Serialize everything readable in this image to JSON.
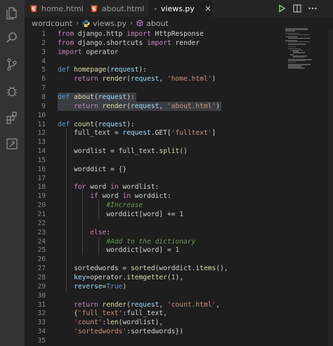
{
  "colors": {
    "activity_bg": "#333333",
    "editor_bg": "#1e1e1e",
    "tab_inactive_bg": "#252526",
    "html_icon": "#e44d26",
    "python_blue": "#3c78aa",
    "python_yellow": "#f7d046",
    "keyword": "#c586c0",
    "string": "#ce9178",
    "function": "#dcdcaa",
    "comment": "#6a9955",
    "number": "#b5cea8",
    "selection": "#3a3d41",
    "run_green": "#89d185"
  },
  "activity_bar": {
    "items": [
      {
        "name": "explorer-icon"
      },
      {
        "name": "search-icon"
      },
      {
        "name": "source-control-icon"
      },
      {
        "name": "run-debug-icon"
      },
      {
        "name": "extensions-icon"
      },
      {
        "name": "remote-explorer-icon"
      }
    ]
  },
  "tabs": [
    {
      "label": "home.html",
      "icon": "html5-icon",
      "active": false
    },
    {
      "label": "about.html",
      "icon": "html5-icon",
      "active": false
    },
    {
      "label": "views.py",
      "icon": "python-icon",
      "active": true,
      "close": "×"
    }
  ],
  "tab_actions": [
    {
      "name": "run-icon"
    },
    {
      "name": "split-editor-icon"
    },
    {
      "name": "more-actions-icon"
    }
  ],
  "breadcrumb": {
    "folder": "wordcount",
    "file": "views.py",
    "symbol": "about",
    "separator": "›"
  },
  "editor": {
    "selected_lines": [
      8,
      9
    ],
    "lines": [
      {
        "n": "1",
        "text": "from django.http import HttpResponse"
      },
      {
        "n": "2",
        "text": "from django.shortcuts import render"
      },
      {
        "n": "3",
        "text": "import operator"
      },
      {
        "n": "4",
        "text": ""
      },
      {
        "n": "5",
        "text": "def homepage(request):"
      },
      {
        "n": "6",
        "text": "    return render(request, 'home.html')"
      },
      {
        "n": "7",
        "text": ""
      },
      {
        "n": "8",
        "text": "def about(request):"
      },
      {
        "n": "9",
        "text": "    return render(request, 'about.html')"
      },
      {
        "n": "10",
        "text": ""
      },
      {
        "n": "11",
        "text": "def count(request):"
      },
      {
        "n": "12",
        "text": "    full_text = request.GET['fulltext']"
      },
      {
        "n": "13",
        "text": ""
      },
      {
        "n": "14",
        "text": "    wordlist = full_text.split()"
      },
      {
        "n": "15",
        "text": ""
      },
      {
        "n": "16",
        "text": "    worddict = {}"
      },
      {
        "n": "17",
        "text": ""
      },
      {
        "n": "18",
        "text": "    for word in wordlist:"
      },
      {
        "n": "19",
        "text": "        if word in worddict:"
      },
      {
        "n": "20",
        "text": "            #Increase"
      },
      {
        "n": "21",
        "text": "            worddict[word] += 1"
      },
      {
        "n": "22",
        "text": ""
      },
      {
        "n": "23",
        "text": "        else:"
      },
      {
        "n": "24",
        "text": "            #Add to the dictionary"
      },
      {
        "n": "25",
        "text": "            worddict[word] = 1"
      },
      {
        "n": "26",
        "text": ""
      },
      {
        "n": "27",
        "text": "    sortedwords = sorted(worddict.items(),"
      },
      {
        "n": "28",
        "text": "    key=operator.itemgetter(1),"
      },
      {
        "n": "29",
        "text": "    reverse=True)"
      },
      {
        "n": "30",
        "text": ""
      },
      {
        "n": "31",
        "text": "    return render(request, 'count.html',"
      },
      {
        "n": "32",
        "text": "    {'full_text':full_text,"
      },
      {
        "n": "33",
        "text": "    'count':len(wordlist),"
      },
      {
        "n": "34",
        "text": "    'sortedwords':sortedwords})"
      },
      {
        "n": "35",
        "text": ""
      }
    ]
  }
}
